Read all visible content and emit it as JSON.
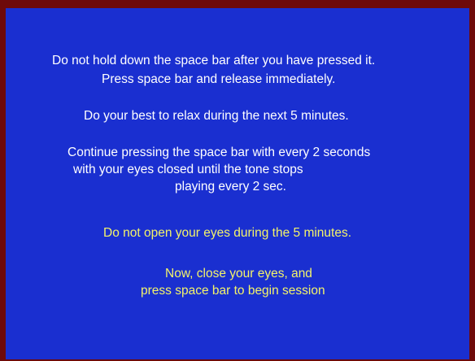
{
  "colors": {
    "border": "#6e0a0a",
    "background": "#1a2fd0",
    "text_primary": "#ffffff",
    "text_warning": "#f3f36a"
  },
  "instructions": {
    "block1": {
      "line1": "Do not hold down the space bar after you have pressed it.",
      "line2": "Press space bar and release immediately."
    },
    "block2": {
      "line1": "Do your best to relax during the next 5 minutes."
    },
    "block3": {
      "line1": "Continue pressing the space bar with every 2 seconds",
      "line2": "with your eyes closed until the tone stops",
      "line3": "playing every 2 sec."
    },
    "warning": {
      "line1": "Do not open your eyes during the 5 minutes."
    },
    "start": {
      "line1": "Now, close your eyes, and",
      "line2": "press space bar to begin session"
    }
  }
}
